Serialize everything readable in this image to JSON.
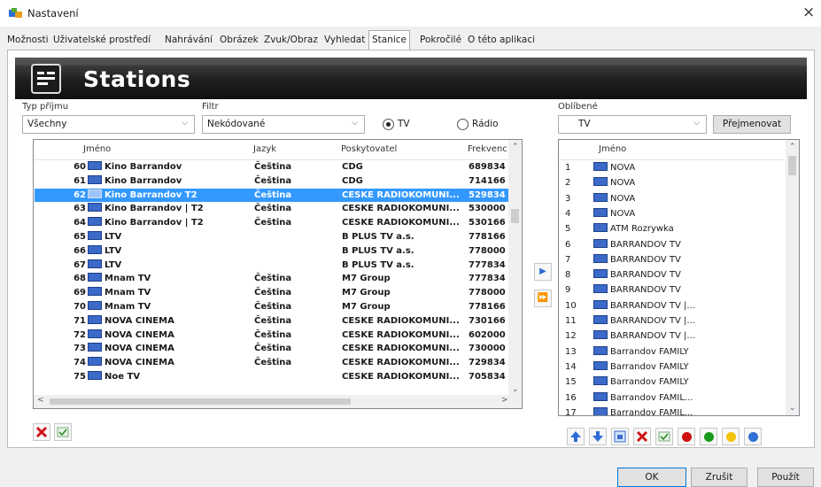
{
  "window": {
    "title": "Nastavení",
    "close_glyph": "×"
  },
  "tabs": [
    "Možnosti",
    "Uživatelské prostředí",
    "Nahrávání",
    "Obrázek",
    "Zvuk/Obraz",
    "Vyhledat",
    "Stanice",
    "Pokročilé",
    "O této aplikaci"
  ],
  "active_tab": "Stanice",
  "header": {
    "title": "Stations"
  },
  "filters": {
    "reception_label": "Typ příjmu",
    "reception_value": "Všechny",
    "filter_label": "Filtr",
    "filter_value": "Nekódované",
    "radio_tv": "TV",
    "radio_radio": "Rádio",
    "selected_radio": "TV"
  },
  "favorites": {
    "label": "Oblíbené",
    "value": "TV",
    "rename_button": "Přejmenovat"
  },
  "stations_table": {
    "columns": [
      "Jméno",
      "Jazyk",
      "Poskytovatel",
      "Frekvenc"
    ],
    "selected_index": 2,
    "rows": [
      {
        "num": "60",
        "name": "Kino Barrandov",
        "lang": "Čeština",
        "provider": "CDG",
        "freq": "689834"
      },
      {
        "num": "61",
        "name": "Kino Barrandov",
        "lang": "Čeština",
        "provider": "CDG",
        "freq": "714166"
      },
      {
        "num": "62",
        "name": "Kino Barrandov T2",
        "lang": "Čeština",
        "provider": "CESKE RADIOKOMUNI...",
        "freq": "529834"
      },
      {
        "num": "63",
        "name": "Kino Barrandov | T2",
        "lang": "Čeština",
        "provider": "CESKE RADIOKOMUNI...",
        "freq": "530000"
      },
      {
        "num": "64",
        "name": "Kino Barrandov | T2",
        "lang": "Čeština",
        "provider": "CESKE RADIOKOMUNI...",
        "freq": "530166"
      },
      {
        "num": "65",
        "name": "LTV",
        "lang": "",
        "provider": "B PLUS TV a.s.",
        "freq": "778166"
      },
      {
        "num": "66",
        "name": "LTV",
        "lang": "",
        "provider": "B PLUS TV a.s.",
        "freq": "778000"
      },
      {
        "num": "67",
        "name": "LTV",
        "lang": "",
        "provider": "B PLUS TV a.s.",
        "freq": "777834"
      },
      {
        "num": "68",
        "name": "Mnam TV",
        "lang": "Čeština",
        "provider": "M7 Group",
        "freq": "777834"
      },
      {
        "num": "69",
        "name": "Mnam TV",
        "lang": "Čeština",
        "provider": "M7 Group",
        "freq": "778000"
      },
      {
        "num": "70",
        "name": "Mnam TV",
        "lang": "Čeština",
        "provider": "M7 Group",
        "freq": "778166"
      },
      {
        "num": "71",
        "name": "NOVA CINEMA",
        "lang": "Čeština",
        "provider": "CESKE RADIOKOMUNI...",
        "freq": "730166"
      },
      {
        "num": "72",
        "name": "NOVA CINEMA",
        "lang": "Čeština",
        "provider": "CESKE RADIOKOMUNI...",
        "freq": "602000"
      },
      {
        "num": "73",
        "name": "NOVA CINEMA",
        "lang": "Čeština",
        "provider": "CESKE RADIOKOMUNI...",
        "freq": "730000"
      },
      {
        "num": "74",
        "name": "NOVA CINEMA",
        "lang": "Čeština",
        "provider": "CESKE RADIOKOMUNI...",
        "freq": "729834"
      },
      {
        "num": "75",
        "name": "Noe TV",
        "lang": "",
        "provider": "CESKE RADIOKOMUNI...",
        "freq": "705834"
      }
    ]
  },
  "favorites_table": {
    "columns": [
      "Jméno"
    ],
    "rows": [
      {
        "num": "1",
        "name": "NOVA"
      },
      {
        "num": "2",
        "name": "NOVA"
      },
      {
        "num": "3",
        "name": "NOVA"
      },
      {
        "num": "4",
        "name": "NOVA"
      },
      {
        "num": "5",
        "name": "ATM Rozrywka"
      },
      {
        "num": "6",
        "name": "BARRANDOV TV"
      },
      {
        "num": "7",
        "name": "BARRANDOV TV"
      },
      {
        "num": "8",
        "name": "BARRANDOV TV"
      },
      {
        "num": "9",
        "name": "BARRANDOV TV"
      },
      {
        "num": "10",
        "name": "BARRANDOV TV |..."
      },
      {
        "num": "11",
        "name": "BARRANDOV TV |..."
      },
      {
        "num": "12",
        "name": "BARRANDOV TV |..."
      },
      {
        "num": "13",
        "name": "Barrandov FAMILY"
      },
      {
        "num": "14",
        "name": "Barrandov FAMILY"
      },
      {
        "num": "15",
        "name": "Barrandov FAMILY"
      },
      {
        "num": "16",
        "name": "Barrandov FAMIL..."
      },
      {
        "num": "17",
        "name": "Barrandov FAMIL..."
      }
    ]
  },
  "transfer_buttons": {
    "add_one": "▶",
    "add_all": "⏩"
  },
  "dot_colors": {
    "red": "#d01010",
    "green": "#1a9a1a",
    "yellow": "#f4c20d",
    "blue": "#2f6fd6"
  },
  "footer": {
    "ok": "OK",
    "cancel": "Zrušit",
    "apply": "Použít"
  }
}
